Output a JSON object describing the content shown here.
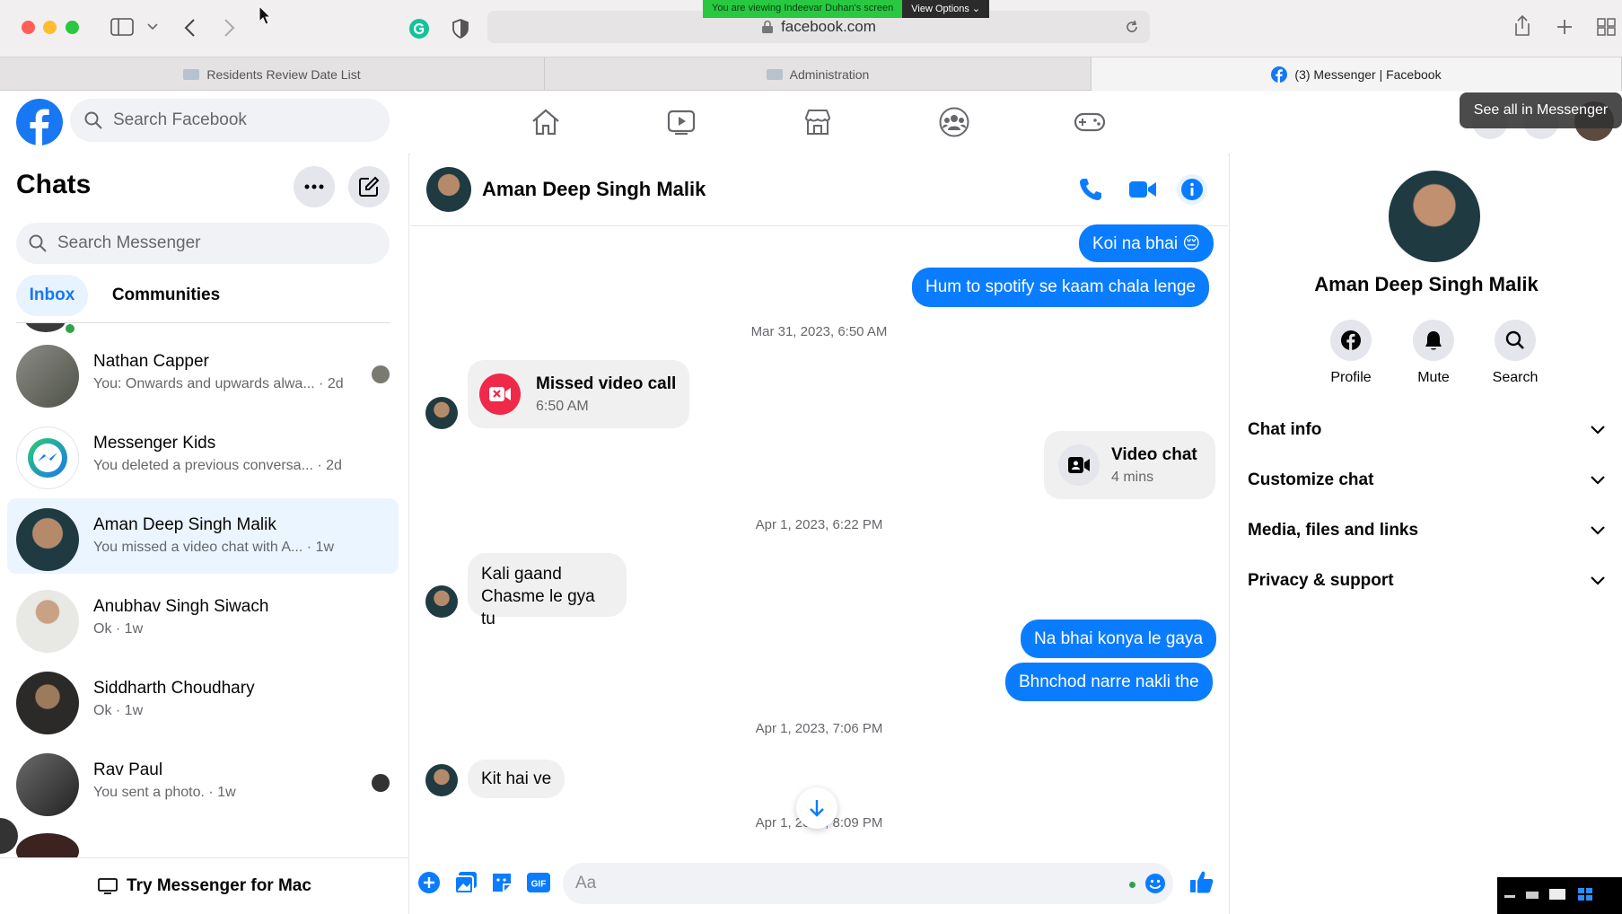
{
  "browser": {
    "url": "facebook.com",
    "share_notice": "You are viewing Indeevar Duhan's screen",
    "view_options": "View Options",
    "tabs": [
      {
        "label": "Residents Review Date List"
      },
      {
        "label": "Administration"
      },
      {
        "label": "(3) Messenger | Facebook"
      }
    ]
  },
  "header": {
    "search_placeholder": "Search Facebook",
    "tooltip": "See all in Messenger"
  },
  "sidebar": {
    "title": "Chats",
    "search_placeholder": "Search Messenger",
    "tabs": [
      "Inbox",
      "Communities"
    ],
    "chats": [
      {
        "name": "Nathan Capper",
        "preview": "You: Onwards and upwards alwa... · 2d"
      },
      {
        "name": "Messenger Kids",
        "preview": "You deleted a previous conversa... · 2d"
      },
      {
        "name": "Aman Deep Singh Malik",
        "preview": "You missed a video chat with A... · 1w"
      },
      {
        "name": "Anubhav Singh Siwach",
        "preview": "Ok · 1w"
      },
      {
        "name": "Siddharth Choudhary",
        "preview": "Ok · 1w"
      },
      {
        "name": "Rav Paul",
        "preview": "You sent a photo. · 1w"
      }
    ],
    "try_mac": "Try Messenger for Mac"
  },
  "conversation": {
    "name": "Aman Deep Singh Malik",
    "messages": [
      {
        "text": "Koi na bhai 😔"
      },
      {
        "text": "Hum to spotify se kaam chala lenge"
      },
      {
        "timestamp": "Mar 31, 2023, 6:50 AM"
      },
      {
        "call_title": "Missed video call",
        "call_sub": "6:50 AM"
      },
      {
        "call_title": "Video chat",
        "call_sub": "4 mins"
      },
      {
        "timestamp": "Apr 1, 2023, 6:22 PM"
      },
      {
        "text_line1": "Kali gaand",
        "text_line2": "Chasme le gya tu"
      },
      {
        "text": "Na bhai konya le gaya"
      },
      {
        "text": "Bhnchod narre nakli the"
      },
      {
        "timestamp": "Apr 1, 2023, 7:06 PM"
      },
      {
        "text": "Kit hai ve"
      },
      {
        "timestamp": "Apr 1, 2023, 8:09 PM"
      }
    ],
    "composer_placeholder": "Aa"
  },
  "details": {
    "name": "Aman Deep Singh Malik",
    "actions": [
      "Profile",
      "Mute",
      "Search"
    ],
    "sections": [
      "Chat info",
      "Customize chat",
      "Media, files and links",
      "Privacy & support"
    ]
  },
  "colors": {
    "accent": "#1877f2",
    "outgoing_bubble": "#0a7cff",
    "missed_call": "#f02849"
  }
}
